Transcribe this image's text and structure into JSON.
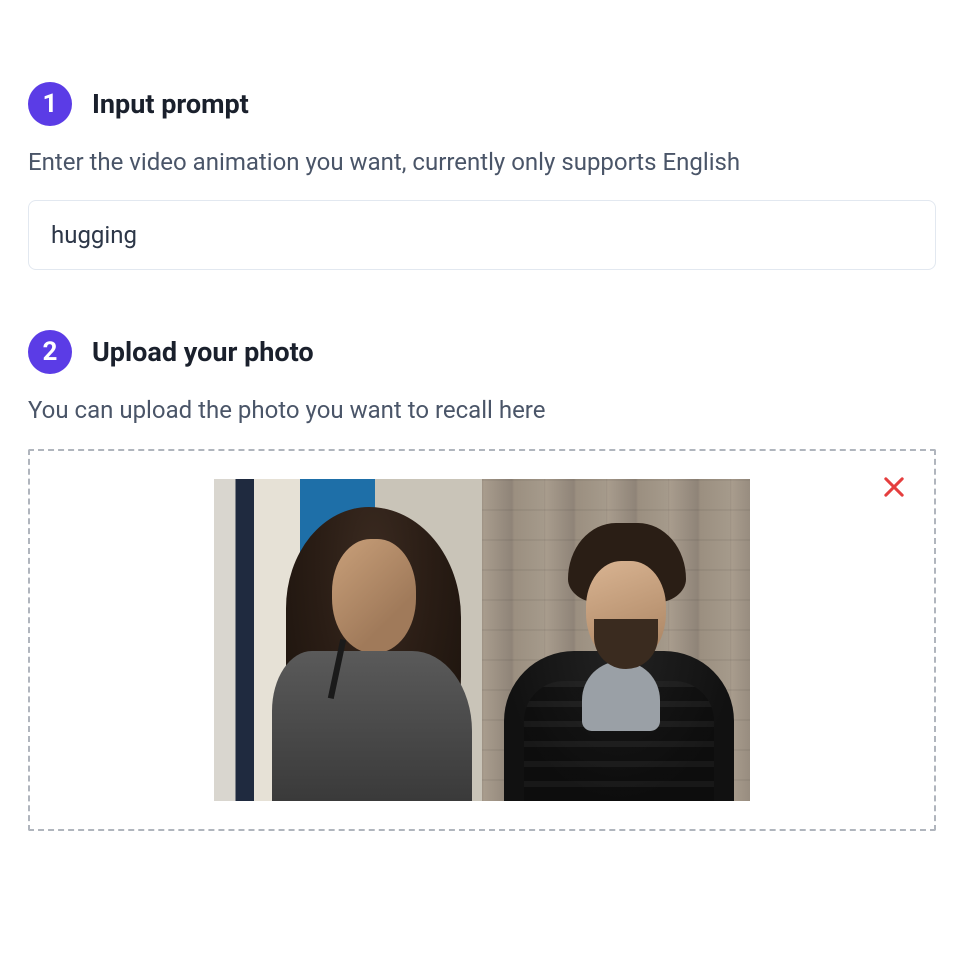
{
  "steps": [
    {
      "number": "1",
      "title": "Input prompt",
      "description": "Enter the video animation you want, currently only supports English",
      "input_value": "hugging"
    },
    {
      "number": "2",
      "title": "Upload your photo",
      "description": "You can upload the photo you want to recall here"
    }
  ],
  "colors": {
    "accent": "#5b3ce6",
    "remove": "#e53e3e"
  }
}
